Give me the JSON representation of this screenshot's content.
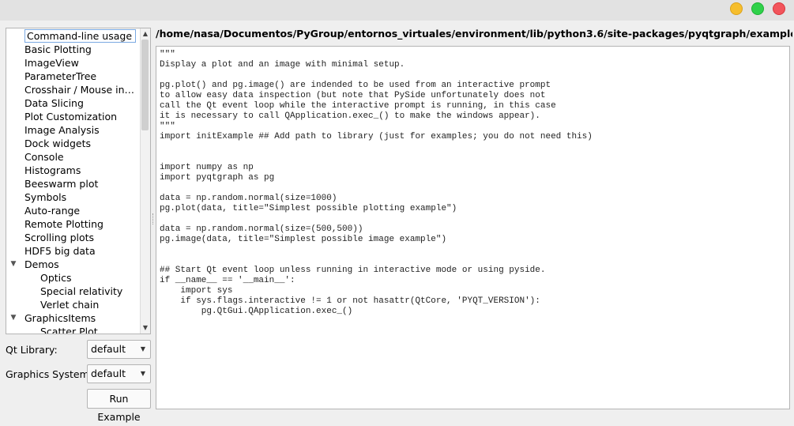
{
  "window": {
    "controls": [
      "minimize",
      "maximize",
      "close"
    ]
  },
  "tree": {
    "items": [
      {
        "label": "Command-line usage",
        "indent": 0,
        "selected": true
      },
      {
        "label": "Basic Plotting",
        "indent": 0
      },
      {
        "label": "ImageView",
        "indent": 0
      },
      {
        "label": "ParameterTree",
        "indent": 0
      },
      {
        "label": "Crosshair / Mouse inter...",
        "indent": 0
      },
      {
        "label": "Data Slicing",
        "indent": 0
      },
      {
        "label": "Plot Customization",
        "indent": 0
      },
      {
        "label": "Image Analysis",
        "indent": 0
      },
      {
        "label": "Dock widgets",
        "indent": 0
      },
      {
        "label": "Console",
        "indent": 0
      },
      {
        "label": "Histograms",
        "indent": 0
      },
      {
        "label": "Beeswarm plot",
        "indent": 0
      },
      {
        "label": "Symbols",
        "indent": 0
      },
      {
        "label": "Auto-range",
        "indent": 0
      },
      {
        "label": "Remote Plotting",
        "indent": 0
      },
      {
        "label": "Scrolling plots",
        "indent": 0
      },
      {
        "label": "HDF5 big data",
        "indent": 0
      },
      {
        "label": "Demos",
        "indent": 0,
        "expandable": true
      },
      {
        "label": "Optics",
        "indent": 1
      },
      {
        "label": "Special relativity",
        "indent": 1
      },
      {
        "label": "Verlet chain",
        "indent": 1
      },
      {
        "label": "GraphicsItems",
        "indent": 0,
        "expandable": true
      },
      {
        "label": "Scatter Plot",
        "indent": 1
      }
    ]
  },
  "controls": {
    "qt_library_label": "Qt Library:",
    "qt_library_value": "default",
    "graphics_system_label": "Graphics System:",
    "graphics_system_value": "default",
    "run_button": "Run Example"
  },
  "editor": {
    "path": "/home/nasa/Documentos/PyGroup/entornos_virtuales/environment/lib/python3.6/site-packages/pyqtgraph/examples/CLIexample.py",
    "code": "\"\"\"\nDisplay a plot and an image with minimal setup.\n\npg.plot() and pg.image() are indended to be used from an interactive prompt\nto allow easy data inspection (but note that PySide unfortunately does not\ncall the Qt event loop while the interactive prompt is running, in this case\nit is necessary to call QApplication.exec_() to make the windows appear).\n\"\"\"\nimport initExample ## Add path to library (just for examples; you do not need this)\n\n\nimport numpy as np\nimport pyqtgraph as pg\n\ndata = np.random.normal(size=1000)\npg.plot(data, title=\"Simplest possible plotting example\")\n\ndata = np.random.normal(size=(500,500))\npg.image(data, title=\"Simplest possible image example\")\n\n\n## Start Qt event loop unless running in interactive mode or using pyside.\nif __name__ == '__main__':\n    import sys\n    if sys.flags.interactive != 1 or not hasattr(QtCore, 'PYQT_VERSION'):\n        pg.QtGui.QApplication.exec_()"
  }
}
